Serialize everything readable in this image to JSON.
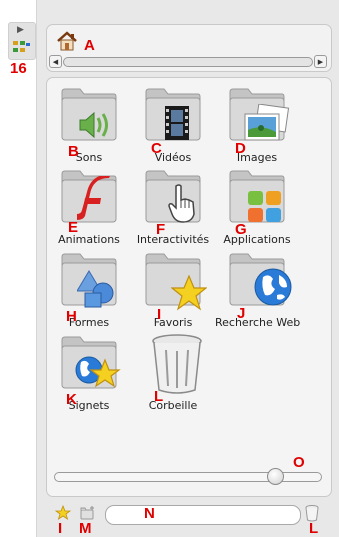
{
  "annotations": {
    "counter": "16",
    "a": "A",
    "b": "B",
    "c": "C",
    "d": "D",
    "e": "E",
    "f": "F",
    "g": "G",
    "h": "H",
    "i": "I",
    "j": "J",
    "k": "K",
    "l": "L",
    "i2": "I",
    "m": "M",
    "n": "N",
    "l2": "L",
    "o": "O"
  },
  "library": {
    "items": [
      {
        "label": "Sons",
        "icon": "speaker-icon"
      },
      {
        "label": "Vidéos",
        "icon": "film-icon"
      },
      {
        "label": "Images",
        "icon": "picture-icon"
      },
      {
        "label": "Animations",
        "icon": "flash-icon"
      },
      {
        "label": "Interactivités",
        "icon": "hand-pointer-icon"
      },
      {
        "label": "Applications",
        "icon": "apps-icon"
      },
      {
        "label": "Formes",
        "icon": "shapes-icon"
      },
      {
        "label": "Favoris",
        "icon": "star-icon"
      },
      {
        "label": "Recherche Web",
        "icon": "globe-icon"
      },
      {
        "label": "Signets",
        "icon": "globe-star-icon"
      },
      {
        "label": "Corbeille",
        "icon": "trash-icon"
      }
    ]
  },
  "thumbnail_size": 0.85,
  "search": {
    "value": ""
  },
  "colors": {
    "annotation": "#e00000",
    "panel": "#e8e8e8",
    "folder": "#cfcfcf"
  }
}
